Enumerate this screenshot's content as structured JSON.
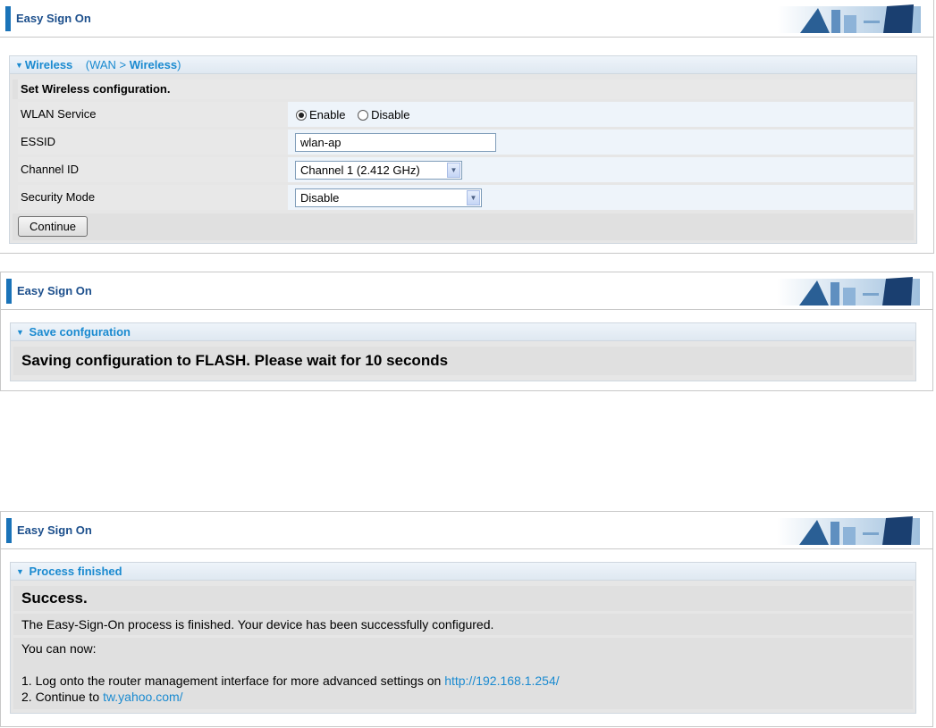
{
  "panel1": {
    "header_title": "Easy Sign On",
    "section_title": "Wireless",
    "crumb_open": "(WAN > ",
    "crumb_current": "Wireless",
    "crumb_close": ")",
    "intro": "Set Wireless configuration.",
    "wlan_label": "WLAN Service",
    "wlan_enable": "Enable",
    "wlan_disable": "Disable",
    "wlan_selected": "Enable",
    "essid_label": "ESSID",
    "essid_value": "wlan-ap",
    "channel_label": "Channel ID",
    "channel_value": "Channel 1 (2.412 GHz)",
    "security_label": "Security Mode",
    "security_value": "Disable",
    "continue_label": "Continue"
  },
  "panel2": {
    "header_title": "Easy Sign On",
    "section_title": "Save confguration",
    "message": "Saving configuration to FLASH. Please wait for 10 seconds"
  },
  "panel3": {
    "header_title": "Easy Sign On",
    "section_title": "Process finished",
    "success": "Success.",
    "finished_text": "The Easy-Sign-On process is finished. Your device has been successfully configured.",
    "you_can_now": "You can now:",
    "step1_text": "1. Log onto the router management interface for more advanced settings on ",
    "step1_link": "http://192.168.1.254/",
    "step2_text": "2. Continue to ",
    "step2_link": "tw.yahoo.com/"
  },
  "colors": {
    "accent": "#1a73b8",
    "link": "#1a8ad0",
    "header_title": "#1c4f8c"
  }
}
